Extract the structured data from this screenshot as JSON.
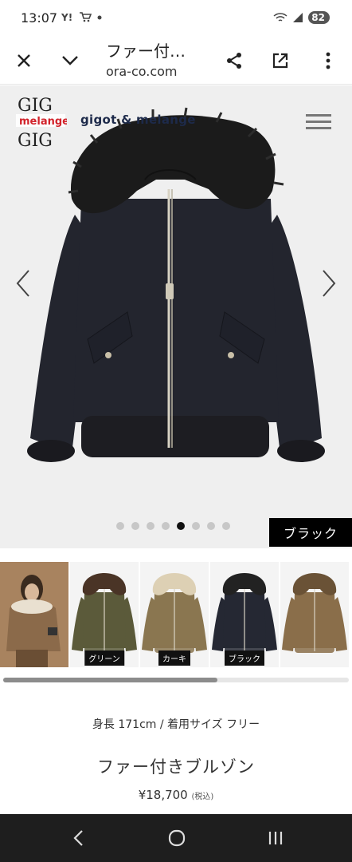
{
  "status_bar": {
    "time": "13:07",
    "battery": "82",
    "icons": [
      "yahoo-icon",
      "cart-icon",
      "dot-icon",
      "wifi-icon",
      "signal-icon",
      "battery-icon"
    ]
  },
  "toolbar": {
    "title": "ファー付…",
    "url": "ora-co.com",
    "icons": [
      "close-icon",
      "chevron-down-icon",
      "share-icon",
      "open-external-icon",
      "more-vert-icon"
    ]
  },
  "hero": {
    "brand_name": "gigot & melange",
    "logo_text_top": "GIG",
    "logo_text_mid": "melange",
    "logo_text_bottom": "GIG",
    "selected_color": "ブラック",
    "slide_count": 8,
    "active_slide": 4,
    "jacket_color": "#23252e",
    "fur_color": "#1b1b1b"
  },
  "thumbnails": [
    {
      "label": "",
      "body": "#8b6a4a",
      "fur": "#e9e0d0",
      "type": "model"
    },
    {
      "label": "グリーン",
      "body": "#5b5a3a",
      "fur": "#4a3426",
      "type": "jacket"
    },
    {
      "label": "カーキ",
      "body": "#8a7650",
      "fur": "#ddd0b4",
      "type": "jacket"
    },
    {
      "label": "ブラック",
      "body": "#252833",
      "fur": "#222222",
      "type": "jacket"
    },
    {
      "label": "",
      "body": "#8a6e4a",
      "fur": "#6a5236",
      "type": "jacket"
    }
  ],
  "scroll": {
    "position_fraction": 0.62
  },
  "product": {
    "model_info": "身長 171cm / 着用サイズ フリー",
    "name": "ファー付きブルゾン",
    "price": "¥18,700",
    "tax_note": "(税込)"
  },
  "navbar": {
    "icons": [
      "back-icon",
      "home-icon",
      "recents-icon"
    ]
  }
}
